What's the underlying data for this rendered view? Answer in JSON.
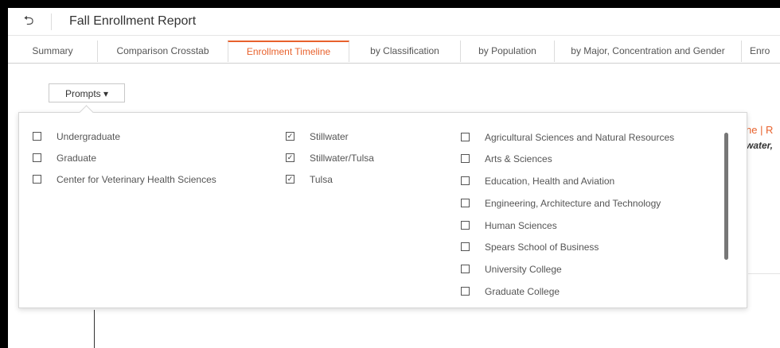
{
  "header": {
    "title": "Fall Enrollment Report",
    "back_icon": "back-arrow-icon"
  },
  "tabs": [
    {
      "label": "Summary",
      "active": false
    },
    {
      "label": "Comparison Crosstab",
      "active": false
    },
    {
      "label": "Enrollment Timeline",
      "active": true
    },
    {
      "label": "by Classification",
      "active": false
    },
    {
      "label": "by Population",
      "active": false
    },
    {
      "label": "by Major, Concentration and Gender",
      "active": false
    },
    {
      "label": "Enro",
      "active": false
    }
  ],
  "prompts": {
    "label": "Prompts ▾"
  },
  "background": {
    "title_fragment": "ne | R",
    "subtitle_fragment": "water,"
  },
  "filters": {
    "level": [
      {
        "label": "Undergraduate",
        "checked": false
      },
      {
        "label": "Graduate",
        "checked": false
      },
      {
        "label": "Center for Veterinary Health Sciences",
        "checked": false
      }
    ],
    "campus": [
      {
        "label": "Stillwater",
        "checked": true
      },
      {
        "label": "Stillwater/Tulsa",
        "checked": true
      },
      {
        "label": "Tulsa",
        "checked": true
      }
    ],
    "college": [
      {
        "label": "Agricultural Sciences and Natural Resources",
        "checked": false
      },
      {
        "label": "Arts & Sciences",
        "checked": false
      },
      {
        "label": "Education, Health and Aviation",
        "checked": false
      },
      {
        "label": "Engineering, Architecture and Technology",
        "checked": false
      },
      {
        "label": "Human Sciences",
        "checked": false
      },
      {
        "label": "Spears School of Business",
        "checked": false
      },
      {
        "label": "University College",
        "checked": false
      },
      {
        "label": "Graduate College",
        "checked": false
      }
    ]
  },
  "colors": {
    "accent": "#e8612c",
    "text": "#555555",
    "border": "#d6d6d6"
  }
}
